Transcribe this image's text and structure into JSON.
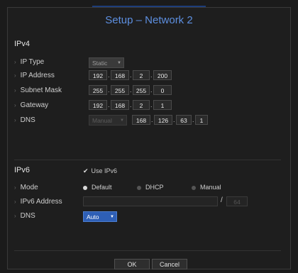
{
  "title": "Setup – Network 2",
  "ipv4": {
    "section_label": "IPv4",
    "ip_type": {
      "label": "IP Type",
      "value": "Static",
      "caret": "▼"
    },
    "ip_address": {
      "label": "IP Address",
      "octets": [
        "192",
        "168",
        "2",
        "200"
      ]
    },
    "subnet_mask": {
      "label": "Subnet Mask",
      "octets": [
        "255",
        "255",
        "255",
        "0"
      ]
    },
    "gateway": {
      "label": "Gateway",
      "octets": [
        "192",
        "168",
        "2",
        "1"
      ]
    },
    "dns": {
      "label": "DNS",
      "mode": "Manual",
      "caret": "▼",
      "octets": [
        "168",
        "126",
        "63",
        "1"
      ]
    }
  },
  "ipv6": {
    "section_label": "IPv6",
    "use_ipv6": {
      "label": "Use IPv6",
      "checked": true,
      "check_glyph": "✔"
    },
    "mode": {
      "label": "Mode",
      "options": [
        "Default",
        "DHCP",
        "Manual"
      ],
      "selected": "Default"
    },
    "address": {
      "label": "IPv6 Address",
      "value": "",
      "slash": "/",
      "prefix": "64"
    },
    "dns": {
      "label": "DNS",
      "value": "Auto",
      "caret": "▼"
    }
  },
  "bullet": "›",
  "dot": ".",
  "buttons": {
    "ok": "OK",
    "cancel": "Cancel"
  },
  "colors": {
    "title": "#5d8fe0",
    "auto_select": "#2e5fb6",
    "background": "#1e1e1e"
  }
}
